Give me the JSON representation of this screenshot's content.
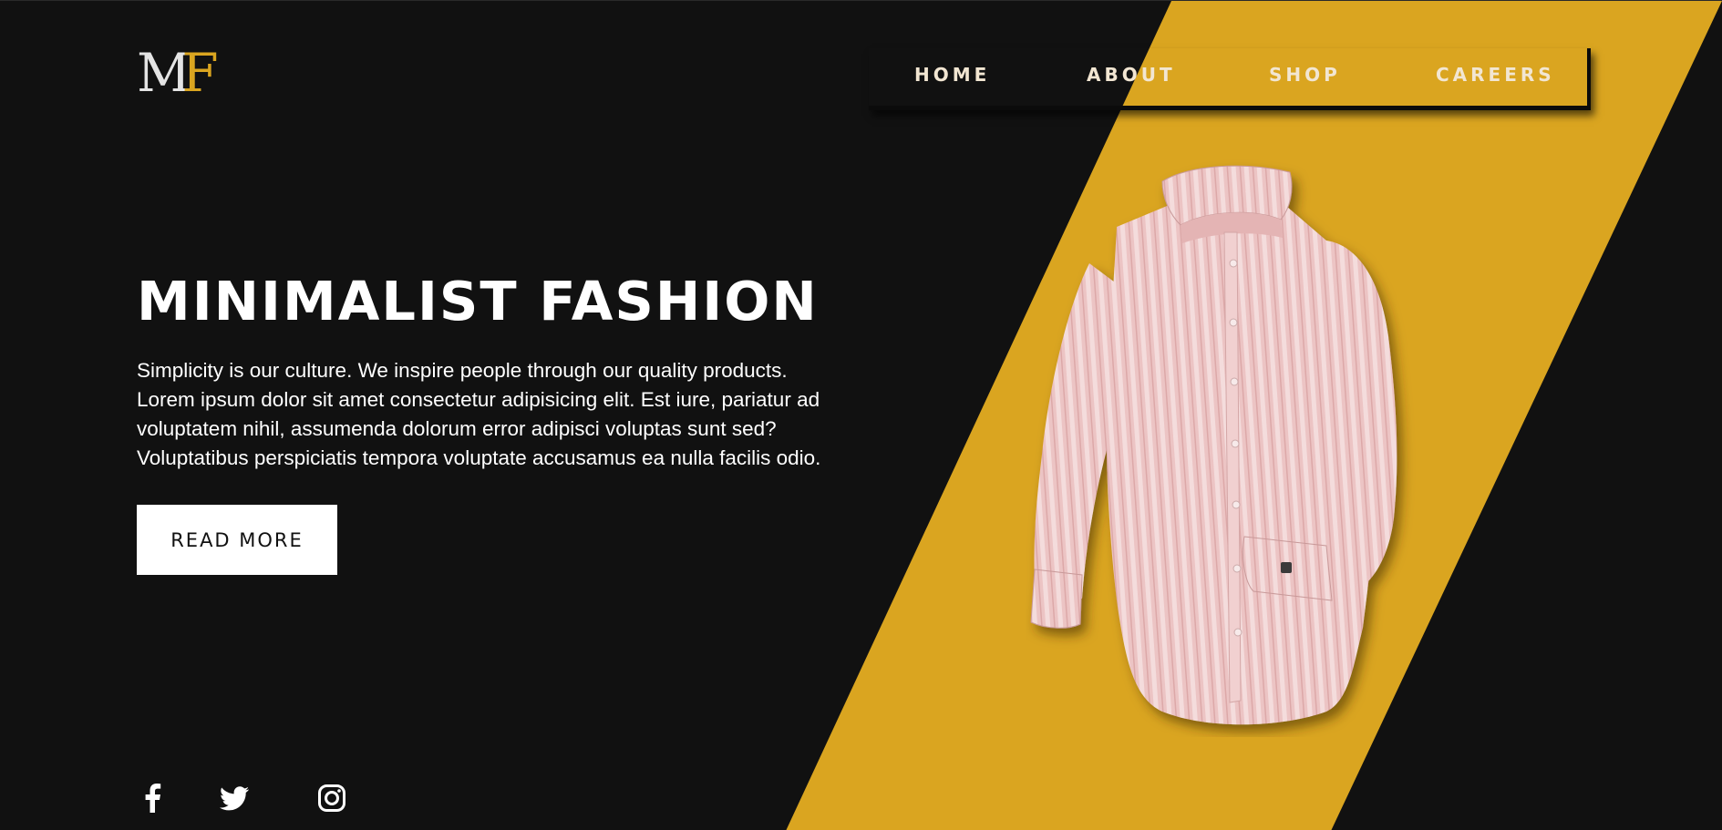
{
  "brand": {
    "logo_m": "M",
    "logo_f": "F"
  },
  "colors": {
    "background": "#111111",
    "accent": "#daa520",
    "shirt": "#e9bcbc",
    "nav_text": "#f2e6d2"
  },
  "nav": {
    "items": [
      {
        "label": "HOME"
      },
      {
        "label": "ABOUT"
      },
      {
        "label": "SHOP"
      },
      {
        "label": "CAREERS"
      }
    ]
  },
  "hero": {
    "title": "MINIMALIST FASHION",
    "lines": [
      "Simplicity is our culture. We inspire people through our quality products.",
      "Lorem ipsum dolor sit amet consectetur adipisicing elit. Est iure, pariatur ad",
      "voluptatem nihil, assumenda dolorum error adipisci voluptas sunt sed?",
      "Voluptatibus perspiciatis tempora voluptate accusamus ea nulla facilis odio."
    ],
    "button_label": "READ MORE"
  },
  "social": {
    "icons": [
      "facebook-icon",
      "twitter-icon",
      "instagram-icon"
    ]
  },
  "image": {
    "subject": "pink-striped-shirt"
  }
}
